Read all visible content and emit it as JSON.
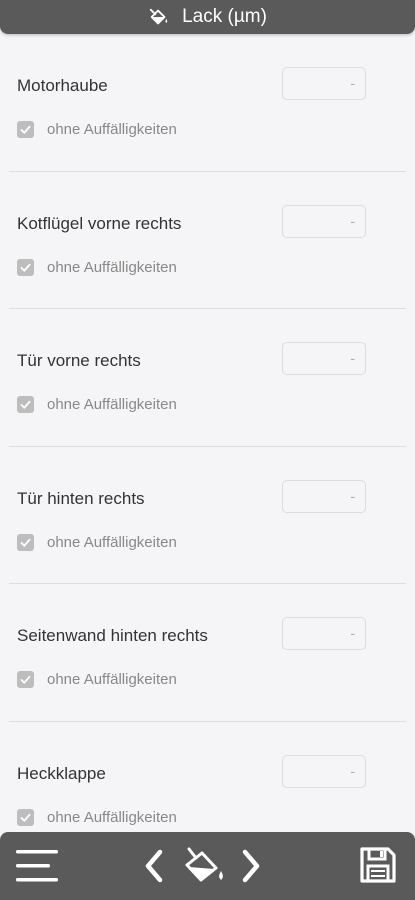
{
  "header": {
    "title": "Lack (µm)",
    "icon": "paint-bucket-icon"
  },
  "rows": [
    {
      "label": "Motorhaube",
      "value": "-",
      "check_label": "ohne Auffälligkeiten",
      "checked": true
    },
    {
      "label": "Kotflügel vorne rechts",
      "value": "-",
      "check_label": "ohne Auffälligkeiten",
      "checked": true
    },
    {
      "label": "Tür vorne rechts",
      "value": "-",
      "check_label": "ohne Auffälligkeiten",
      "checked": true
    },
    {
      "label": "Tür hinten rechts",
      "value": "-",
      "check_label": "ohne Auffälligkeiten",
      "checked": true
    },
    {
      "label": "Seitenwand hinten rechts",
      "value": "-",
      "check_label": "ohne Auffälligkeiten",
      "checked": true
    },
    {
      "label": "Heckklappe",
      "value": "-",
      "check_label": "ohne Auffälligkeiten",
      "checked": true
    }
  ],
  "bottom_bar": {
    "icons": [
      "menu-icon",
      "chevron-left-icon",
      "paint-bucket-icon",
      "chevron-right-icon",
      "save-icon"
    ]
  },
  "colors": {
    "bar_background": "#5a5a5a",
    "page_background": "#f5f5f7",
    "checkbox": "#bdbdbd"
  }
}
